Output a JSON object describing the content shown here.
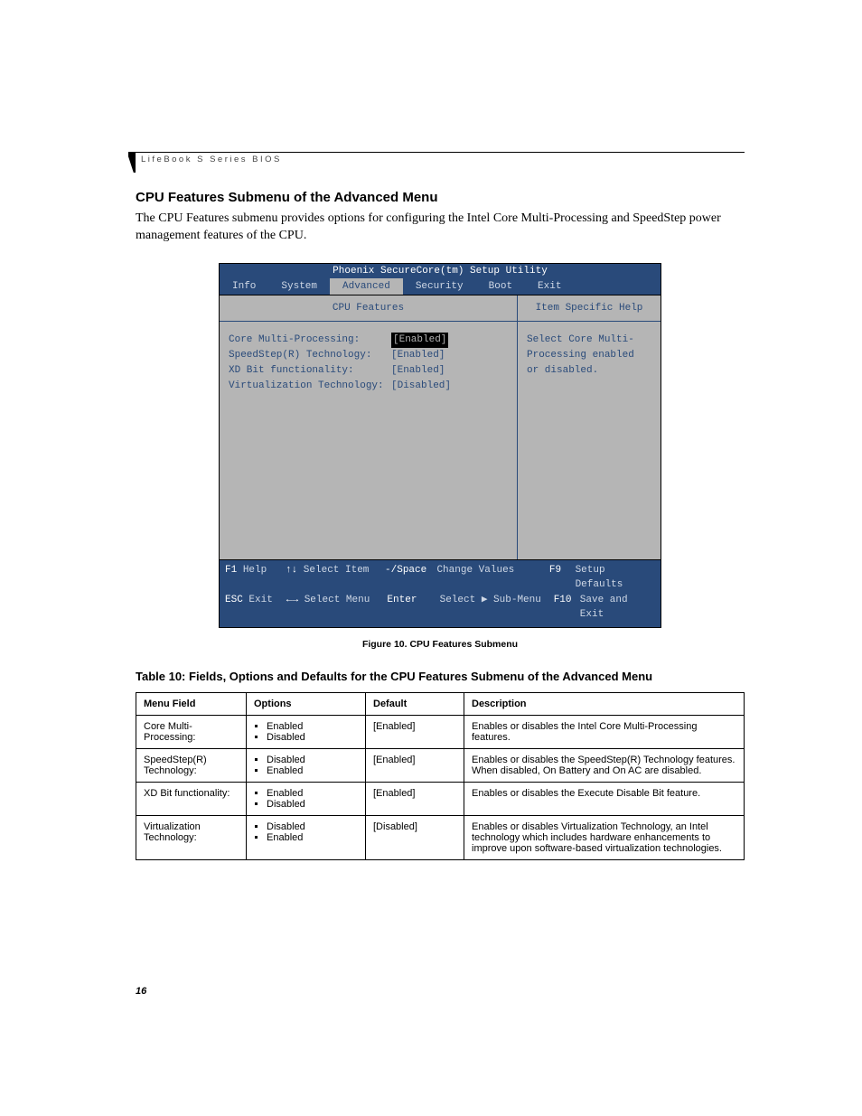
{
  "running_head": "LifeBook S Series BIOS",
  "section_title": "CPU Features Submenu of the Advanced Menu",
  "intro_para": "The CPU Features submenu provides options for configuring the Intel Core Multi-Processing and SpeedStep power management features of the CPU.",
  "bios": {
    "title": "Phoenix SecureCore(tm) Setup Utility",
    "menu": [
      "Info",
      "System",
      "Advanced",
      "Security",
      "Boot",
      "Exit"
    ],
    "active_menu": "Advanced",
    "left_heading": "CPU Features",
    "right_heading": "Item Specific Help",
    "settings": [
      {
        "label": "Core Multi-Processing:",
        "value": "[Enabled]",
        "selected": true
      },
      {
        "label": "SpeedStep(R) Technology:",
        "value": "[Enabled]",
        "selected": false
      },
      {
        "label": "XD Bit functionality:",
        "value": "[Enabled]",
        "selected": false
      },
      {
        "label": "Virtualization Technology:",
        "value": "[Disabled]",
        "selected": false
      }
    ],
    "help_text": "Select Core Multi-Processing enabled or disabled.",
    "footer": {
      "row1": {
        "k1": "F1",
        "t1": "Help",
        "k2": "↑↓",
        "t2": "Select Item",
        "k3": "-/Space",
        "t3": "Change Values",
        "k4": "F9",
        "t4": "Setup Defaults"
      },
      "row2": {
        "k1": "ESC",
        "t1": "Exit",
        "k2": "←→",
        "t2": "Select Menu",
        "k3": "Enter",
        "t3": "Select ▶ Sub-Menu",
        "k4": "F10",
        "t4": "Save and Exit"
      }
    }
  },
  "figure_caption": "Figure 10.  CPU Features Submenu",
  "table_title": "Table 10: Fields, Options and Defaults for the CPU Features Submenu of the Advanced Menu",
  "table": {
    "headers": [
      "Menu Field",
      "Options",
      "Default",
      "Description"
    ],
    "rows": [
      {
        "field": "Core Multi-Processing:",
        "options": [
          "Enabled",
          "Disabled"
        ],
        "default": "[Enabled]",
        "desc": "Enables or disables the Intel Core Multi-Processing features."
      },
      {
        "field": "SpeedStep(R) Technology:",
        "options": [
          "Disabled",
          "Enabled"
        ],
        "default": "[Enabled]",
        "desc": "Enables or disables the SpeedStep(R) Technology features. When disabled, On Battery and On AC are disabled."
      },
      {
        "field": "XD Bit functionality:",
        "options": [
          "Enabled",
          "Disabled"
        ],
        "default": "[Enabled]",
        "desc": "Enables or disables the Execute Disable Bit feature."
      },
      {
        "field": "Virtualization Technology:",
        "options": [
          "Disabled",
          "Enabled"
        ],
        "default": "[Disabled]",
        "desc": "Enables or disables Virtualization Technology, an Intel technology which includes hardware enhancements to improve upon software-based virtualization technologies."
      }
    ]
  },
  "page_number": "16"
}
